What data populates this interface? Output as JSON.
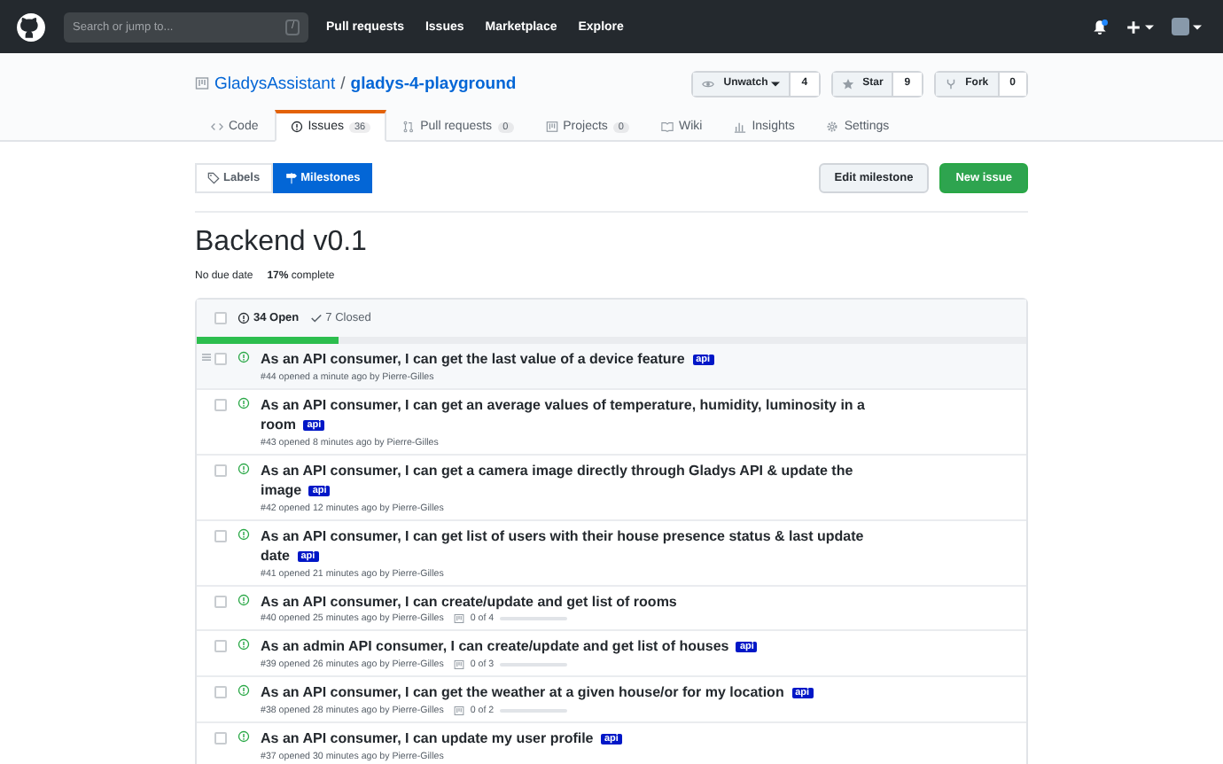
{
  "topbar": {
    "search": {
      "placeholder": "Search or jump to...",
      "key": "/"
    },
    "links": [
      "Pull requests",
      "Issues",
      "Marketplace",
      "Explore"
    ]
  },
  "repo": {
    "owner": "GladysAssistant",
    "separator": "/",
    "name": "gladys-4-playground",
    "actions": [
      {
        "label": "Unwatch",
        "count": "4",
        "caret": true
      },
      {
        "label": "Star",
        "count": "9",
        "caret": false
      },
      {
        "label": "Fork",
        "count": "0",
        "caret": false
      }
    ]
  },
  "tabs": [
    {
      "label": "Code",
      "selected": false
    },
    {
      "label": "Issues",
      "count": "36",
      "selected": true
    },
    {
      "label": "Pull requests",
      "count": "0",
      "selected": false
    },
    {
      "label": "Projects",
      "count": "0",
      "selected": false
    },
    {
      "label": "Wiki",
      "selected": false
    },
    {
      "label": "Insights",
      "selected": false
    },
    {
      "label": "Settings",
      "selected": false
    }
  ],
  "subnav": [
    {
      "label": "Labels",
      "selected": false
    },
    {
      "label": "Milestones",
      "selected": true
    }
  ],
  "buttons": [
    {
      "label": "Edit milestone",
      "kind": "default"
    },
    {
      "label": "New issue",
      "kind": "primary"
    }
  ],
  "milestone": {
    "title": "Backend v0.1",
    "due": "No due date",
    "complete_pct": "17%",
    "complete_label": "complete",
    "level": 0.17
  },
  "select_all": {
    "checked": false
  },
  "states": [
    {
      "label": "34 Open",
      "selected": true
    },
    {
      "label": "7 Closed",
      "selected": false
    }
  ],
  "issues": [
    {
      "title": "As an API consumer, I can get the last value of a device feature",
      "labels": [
        "api"
      ],
      "meta": "#44 opened a minute ago by Pierre-Gilles",
      "hover": true,
      "checked": false
    },
    {
      "title": "As an API consumer, I can get an average values of temperature, humidity, luminosity in a room",
      "labels": [
        "api"
      ],
      "meta": "#43 opened 8 minutes ago by Pierre-Gilles",
      "hover": false,
      "checked": false
    },
    {
      "title": "As an API consumer, I can get a camera image directly through Gladys API & update the image",
      "labels": [
        "api"
      ],
      "meta": "#42 opened 12 minutes ago by Pierre-Gilles",
      "hover": false,
      "checked": false
    },
    {
      "title": "As an API consumer, I can get list of users with their house presence status & last update date",
      "labels": [
        "api"
      ],
      "meta": "#41 opened 21 minutes ago by Pierre-Gilles",
      "hover": false,
      "checked": false
    },
    {
      "title": "As an API consumer, I can create/update and get list of rooms",
      "meta": "#40 opened 25 minutes ago by Pierre-Gilles",
      "tasks": {
        "text": "0 of 4",
        "level": 0
      },
      "hover": false,
      "checked": false
    },
    {
      "title": "As an admin API consumer, I can create/update and get list of houses",
      "labels": [
        "api"
      ],
      "meta": "#39 opened 26 minutes ago by Pierre-Gilles",
      "tasks": {
        "text": "0 of 3",
        "level": 0
      },
      "hover": false,
      "checked": false
    },
    {
      "title": "As an API consumer, I can get the weather at a given house/or for my location",
      "labels": [
        "api"
      ],
      "meta": "#38 opened 28 minutes ago by Pierre-Gilles",
      "tasks": {
        "text": "0 of 2",
        "level": 0
      },
      "hover": false,
      "checked": false
    },
    {
      "title": "As an API consumer, I can update my user profile",
      "labels": [
        "api"
      ],
      "meta": "#37 opened 30 minutes ago by Pierre-Gilles",
      "hover": false,
      "checked": false
    }
  ]
}
